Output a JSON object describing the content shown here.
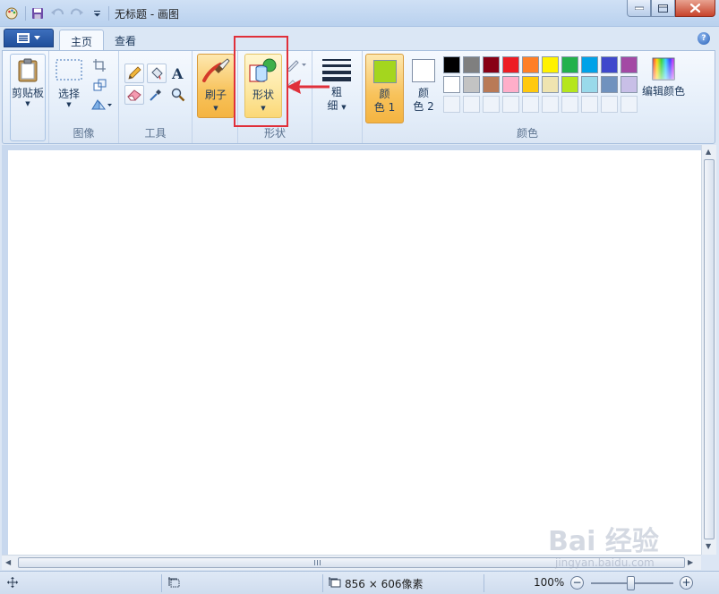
{
  "window": {
    "title": "无标题 - 画图"
  },
  "tabs": [
    {
      "label": "主页"
    },
    {
      "label": "查看"
    }
  ],
  "groups": {
    "clipboard": {
      "label": "剪贴板"
    },
    "image": {
      "label": "图像",
      "select_label": "选择"
    },
    "tools": {
      "label": "工具"
    },
    "brush": {
      "label": "刷子"
    },
    "shapes": {
      "label": "形状",
      "button_label": "形状"
    },
    "size": {
      "label_top": "粗",
      "label_bottom": "细"
    },
    "colors": {
      "label": "颜色",
      "color1_top": "颜",
      "color1_bottom": "色 1",
      "color2_top": "颜",
      "color2_bottom": "色 2",
      "color1_value": "#a4d61e",
      "color2_value": "#ffffff",
      "edit_label": "编辑颜色",
      "palette_row1": [
        "#000000",
        "#7f7f7f",
        "#880015",
        "#ed1c24",
        "#ff7f27",
        "#fff200",
        "#22b14c",
        "#00a2e8",
        "#3f48cc",
        "#a349a4"
      ],
      "palette_row2": [
        "#ffffff",
        "#c3c3c3",
        "#b97a57",
        "#ffaec9",
        "#ffc90e",
        "#efe4b0",
        "#b5e61d",
        "#99d9ea",
        "#7092be",
        "#c8bfe7"
      ]
    }
  },
  "status": {
    "canvas_size": "856 × 606像素",
    "zoom": "100%"
  },
  "watermark": {
    "brand": "Bai 经验",
    "url": "jingyan.baidu.com"
  }
}
